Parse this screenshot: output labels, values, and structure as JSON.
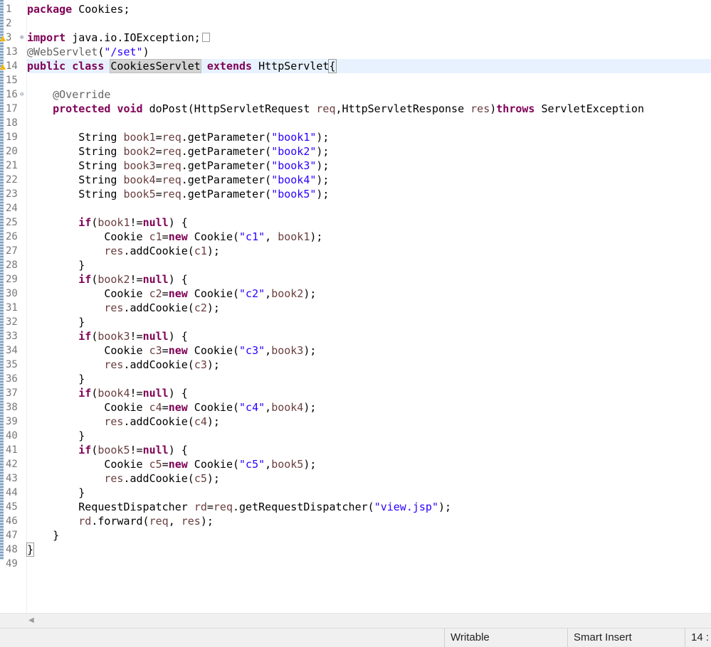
{
  "editor": {
    "line_numbers": [
      "1",
      "2",
      "3",
      "13",
      "14",
      "15",
      "16",
      "17",
      "18",
      "19",
      "20",
      "21",
      "22",
      "23",
      "24",
      "25",
      "26",
      "27",
      "28",
      "29",
      "30",
      "31",
      "32",
      "33",
      "34",
      "35",
      "36",
      "37",
      "38",
      "39",
      "40",
      "41",
      "42",
      "43",
      "44",
      "45",
      "46",
      "47",
      "48",
      "49"
    ],
    "code": {
      "l1": {
        "kw": "package",
        "rest": " Cookies;"
      },
      "l3": {
        "kw": "import",
        "rest": " java.io.IOException;"
      },
      "l13": {
        "ann": "@WebServlet",
        "p1": "(",
        "str": "\"/set\"",
        "p2": ")"
      },
      "l14": {
        "kw1": "public",
        "kw2": "class",
        "name": "CookiesServlet",
        "kw3": "extends",
        "base": " HttpServlet",
        "brace": "{"
      },
      "l16": {
        "ann": "@Override"
      },
      "l17": {
        "kw1": "protected",
        "kw2": "void",
        "m": " doPost(HttpServletRequest ",
        "v1": "req",
        "m2": ",HttpServletResponse ",
        "v2": "res",
        "m3": ")",
        "kw3": "throws",
        "m4": " ServletException"
      },
      "l19": {
        "t": "String ",
        "v": "book1",
        "a": "=",
        "r": "req",
        "b": ".getParameter(",
        "s": "\"book1\"",
        "e": ");"
      },
      "l20": {
        "t": "String ",
        "v": "book2",
        "a": "=",
        "r": "req",
        "b": ".getParameter(",
        "s": "\"book2\"",
        "e": ");"
      },
      "l21": {
        "t": "String ",
        "v": "book3",
        "a": "=",
        "r": "req",
        "b": ".getParameter(",
        "s": "\"book3\"",
        "e": ");"
      },
      "l22": {
        "t": "String ",
        "v": "book4",
        "a": "=",
        "r": "req",
        "b": ".getParameter(",
        "s": "\"book4\"",
        "e": ");"
      },
      "l23": {
        "t": "String ",
        "v": "book5",
        "a": "=",
        "r": "req",
        "b": ".getParameter(",
        "s": "\"book5\"",
        "e": ");"
      },
      "l25": {
        "kw": "if",
        "o": "(",
        "v": "book1",
        "n": "!=",
        "kwn": "null",
        "c": ") {"
      },
      "l26": {
        "t": "Cookie ",
        "v": "c1",
        "e": "=",
        "kw": "new",
        "c": " Cookie(",
        "s": "\"c1\"",
        "m": ", ",
        "b": "book1",
        "z": ");"
      },
      "l27": {
        "r": "res",
        "m": ".addCookie(",
        "v": "c1",
        "z": ");"
      },
      "l28": {
        "t": "}"
      },
      "l29": {
        "kw": "if",
        "o": "(",
        "v": "book2",
        "n": "!=",
        "kwn": "null",
        "c": ") {"
      },
      "l30": {
        "t": "Cookie ",
        "v": "c2",
        "e": "=",
        "kw": "new",
        "c": " Cookie(",
        "s": "\"c2\"",
        "m": ",",
        "b": "book2",
        "z": ");"
      },
      "l31": {
        "r": "res",
        "m": ".addCookie(",
        "v": "c2",
        "z": ");"
      },
      "l32": {
        "t": "}"
      },
      "l33": {
        "kw": "if",
        "o": "(",
        "v": "book3",
        "n": "!=",
        "kwn": "null",
        "c": ") {"
      },
      "l34": {
        "t": "Cookie ",
        "v": "c3",
        "e": "=",
        "kw": "new",
        "c": " Cookie(",
        "s": "\"c3\"",
        "m": ",",
        "b": "book3",
        "z": ");"
      },
      "l35": {
        "r": "res",
        "m": ".addCookie(",
        "v": "c3",
        "z": ");"
      },
      "l36": {
        "t": "}"
      },
      "l37": {
        "kw": "if",
        "o": "(",
        "v": "book4",
        "n": "!=",
        "kwn": "null",
        "c": ") {"
      },
      "l38": {
        "t": "Cookie ",
        "v": "c4",
        "e": "=",
        "kw": "new",
        "c": " Cookie(",
        "s": "\"c4\"",
        "m": ",",
        "b": "book4",
        "z": ");"
      },
      "l39": {
        "r": "res",
        "m": ".addCookie(",
        "v": "c4",
        "z": ");"
      },
      "l40": {
        "t": "}"
      },
      "l41": {
        "kw": "if",
        "o": "(",
        "v": "book5",
        "n": "!=",
        "kwn": "null",
        "c": ") {"
      },
      "l42": {
        "t": "Cookie ",
        "v": "c5",
        "e": "=",
        "kw": "new",
        "c": " Cookie(",
        "s": "\"c5\"",
        "m": ",",
        "b": "book5",
        "z": ");"
      },
      "l43": {
        "r": "res",
        "m": ".addCookie(",
        "v": "c5",
        "z": ");"
      },
      "l44": {
        "t": "}"
      },
      "l45": {
        "t": "RequestDispatcher ",
        "v": "rd",
        "e": "=",
        "r": "req",
        "m": ".getRequestDispatcher(",
        "s": "\"view.jsp\"",
        "z": ");"
      },
      "l46": {
        "v": "rd",
        "m": ".forward(",
        "r1": "req",
        "c": ", ",
        "r2": "res",
        "z": ");"
      },
      "l47": {
        "t": "}"
      },
      "l48": {
        "t": "}"
      }
    },
    "collapsed_marker_icon": "collapsed-region-icon",
    "fold_expanded_glyph": "⊖",
    "fold_collapsed_glyph": "⊕"
  },
  "status_bar": {
    "writable": "Writable",
    "insert_mode": "Smart Insert",
    "position": "14 :"
  },
  "colors": {
    "keyword": "#7f0055",
    "string": "#2a00ff",
    "annotation": "#646464",
    "variable": "#6a3e3e",
    "current_line": "#e8f2fe"
  }
}
